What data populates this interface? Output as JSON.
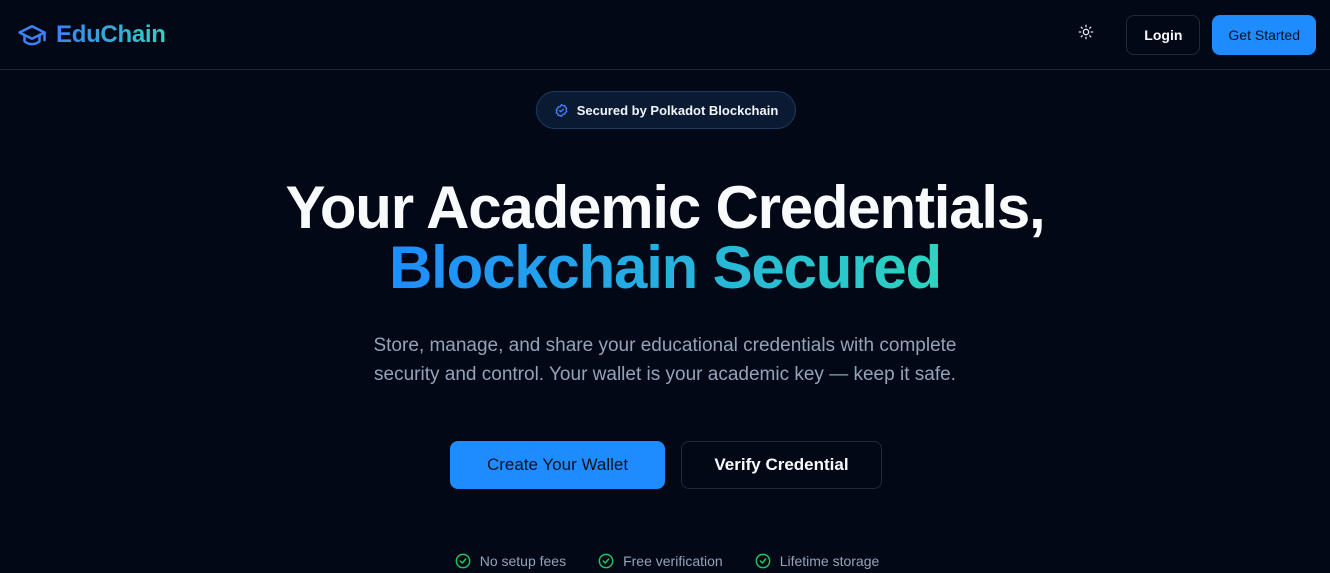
{
  "header": {
    "brand": "EduChain",
    "login_label": "Login",
    "get_started_label": "Get Started"
  },
  "badge": {
    "text": "Secured by Polkadot Blockchain"
  },
  "hero": {
    "title_line1": "Your Academic Credentials,",
    "title_line2": "Blockchain Secured",
    "subtitle_line1": "Store, manage, and share your educational credentials with complete",
    "subtitle_line2": "security and control. Your wallet is your academic key — keep it safe."
  },
  "cta": {
    "primary_label": "Create Your Wallet",
    "secondary_label": "Verify Credential"
  },
  "features": [
    {
      "label": "No setup fees",
      "icon": "check-circle-icon"
    },
    {
      "label": "Free verification",
      "icon": "check-circle-icon"
    },
    {
      "label": "Lifetime storage",
      "icon": "check-circle-icon"
    }
  ],
  "colors": {
    "background": "#030817",
    "accent": "#1e8cff",
    "accent_teal": "#2dd4bf",
    "success": "#22c55e"
  }
}
